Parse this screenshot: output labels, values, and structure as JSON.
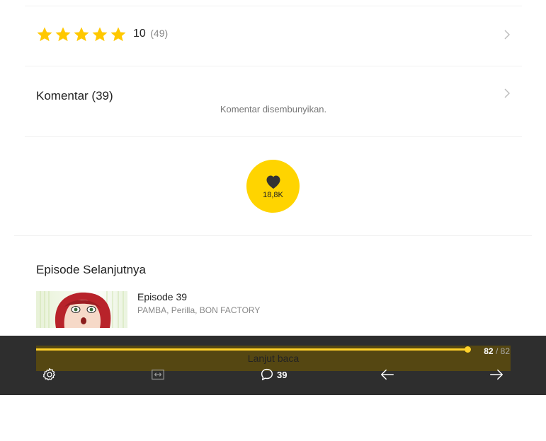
{
  "rating": {
    "stars": 5,
    "score": "10",
    "count": "(49)"
  },
  "comments": {
    "title": "Komentar (39)",
    "hidden_note": "Komentar disembunyikan."
  },
  "like": {
    "count": "18,8K"
  },
  "next_episode": {
    "heading": "Episode Selanjutnya",
    "title": "Episode 39",
    "authors": "PAMBA, Perilla, BON FACTORY"
  },
  "reader_bar": {
    "read_label": "Lanjut baca",
    "progress_current": "82",
    "progress_separator": "/",
    "progress_total": "82",
    "progress_fraction": 1.0,
    "comment_count": "39",
    "icons": [
      "gear-icon",
      "fit-width-icon",
      "comment-icon",
      "arrow-left-icon",
      "arrow-right-icon"
    ]
  },
  "colors": {
    "accent": "#ffd400",
    "star": "#ffc800",
    "bar_background": "#2e2e2e"
  }
}
